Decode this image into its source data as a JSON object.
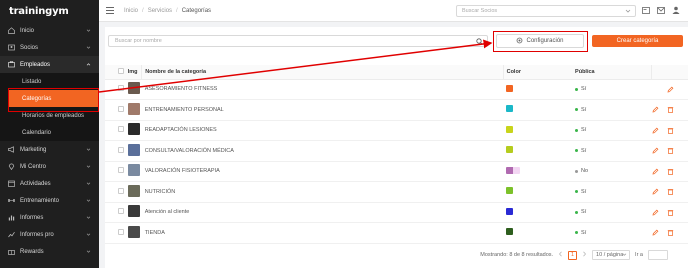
{
  "app": {
    "logo": "trainingym"
  },
  "sidebar": {
    "items": [
      {
        "label": "Inicio",
        "icon": "home-icon"
      },
      {
        "label": "Socios",
        "icon": "users-icon"
      },
      {
        "label": "Empleados",
        "icon": "employee-icon",
        "open": true
      },
      {
        "label": "Marketing",
        "icon": "megaphone-icon"
      },
      {
        "label": "Mi Centro",
        "icon": "location-icon"
      },
      {
        "label": "Actividades",
        "icon": "calendar-icon"
      },
      {
        "label": "Entrenamiento",
        "icon": "dumbbell-icon"
      },
      {
        "label": "Informes",
        "icon": "chart-icon"
      },
      {
        "label": "Informes pro",
        "icon": "chart-pro-icon"
      },
      {
        "label": "Rewards",
        "icon": "gift-icon"
      }
    ],
    "sub_items": [
      {
        "label": "Listado"
      },
      {
        "label": "Categorías",
        "active": true
      },
      {
        "label": "Horarios de empleados"
      },
      {
        "label": "Calendario"
      }
    ]
  },
  "topbar": {
    "breadcrumb": [
      "Inicio",
      "Servicios",
      "Categorías"
    ],
    "search_placeholder": "Buscar Socios"
  },
  "toolbar": {
    "search_placeholder": "Buscar por nombre",
    "config_label": "Configuración",
    "create_label": "Crear categoría"
  },
  "table": {
    "headers": {
      "img": "Img",
      "name": "Nombre de la categoría",
      "color": "Color",
      "public": "Pública"
    },
    "rows": [
      {
        "name": "ASESORAMIENTO FITNESS",
        "color": "#f26522",
        "public": "Sí",
        "thumb": "#6a5a4e"
      },
      {
        "name": "ENTRENAMIENTO PERSONAL",
        "color": "#1bb8c8",
        "public": "Sí",
        "thumb": "#a07a6a"
      },
      {
        "name": "READAPTACIÓN LESIONES",
        "color": "#c8d41b",
        "public": "Sí",
        "thumb": "#2b2b2b"
      },
      {
        "name": "CONSULTA/VALORACIÓN MÉDICA",
        "color": "#b5cc1e",
        "public": "Sí",
        "thumb": "#5a6f9a"
      },
      {
        "name": "VALORACIÓN FISIOTERAPIA",
        "color": "#b06ab0",
        "public": "No",
        "thumb": "#7a8aa0"
      },
      {
        "name": "NUTRICIÓN",
        "color": "#7cc12a",
        "public": "Sí",
        "thumb": "#6b6b5a"
      },
      {
        "name": "Atención al cliente",
        "color": "#2a2ad4",
        "public": "Sí",
        "thumb": "#3a3a3a"
      },
      {
        "name": "TIENDA",
        "color": "#2e5e1e",
        "public": "Sí",
        "thumb": "#4a4a4a"
      }
    ]
  },
  "pager": {
    "summary": "Mostrando: 8 de 8 resultados.",
    "current_page": "1",
    "page_size": "10 / página",
    "goto": "Ir a"
  },
  "colors": {
    "accent": "#f26522",
    "sidebar_bg": "#1f1f1f",
    "annotation": "#e00000",
    "yes_dot": "#3ab54a",
    "no_dot": "#999999"
  }
}
